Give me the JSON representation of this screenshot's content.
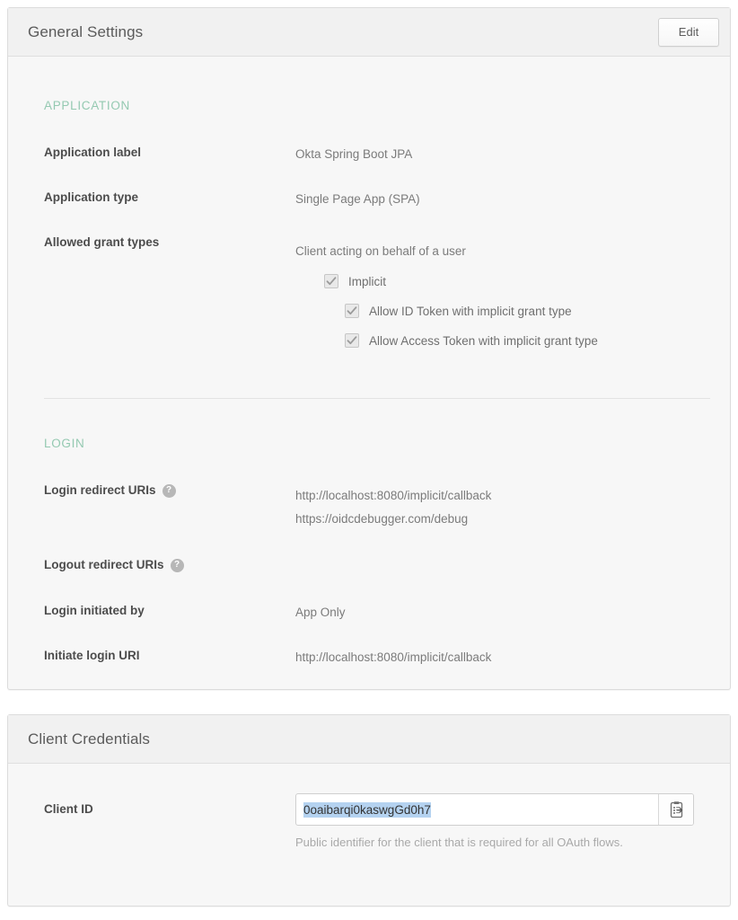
{
  "general_settings": {
    "title": "General Settings",
    "edit_label": "Edit",
    "application": {
      "heading": "APPLICATION",
      "rows": [
        {
          "label": "Application label",
          "value": "Okta Spring Boot JPA"
        },
        {
          "label": "Application type",
          "value": "Single Page App (SPA)"
        }
      ],
      "grant_types": {
        "label": "Allowed grant types",
        "group_label": "Client acting on behalf of a user",
        "checkboxes": [
          {
            "label": "Implicit",
            "checked": true,
            "indent": 0
          },
          {
            "label": "Allow ID Token with implicit grant type",
            "checked": true,
            "indent": 1
          },
          {
            "label": "Allow Access Token with implicit grant type",
            "checked": true,
            "indent": 1
          }
        ]
      }
    },
    "login": {
      "heading": "LOGIN",
      "login_redirect_uris": {
        "label": "Login redirect URIs",
        "help": "?",
        "values": [
          "http://localhost:8080/implicit/callback",
          "https://oidcdebugger.com/debug"
        ]
      },
      "logout_redirect_uris": {
        "label": "Logout redirect URIs",
        "help": "?",
        "values": []
      },
      "login_initiated_by": {
        "label": "Login initiated by",
        "value": "App Only"
      },
      "initiate_login_uri": {
        "label": "Initiate login URI",
        "value": "http://localhost:8080/implicit/callback"
      }
    }
  },
  "client_credentials": {
    "title": "Client Credentials",
    "client_id": {
      "label": "Client ID",
      "value": "0oaibarqi0kaswgGd0h7",
      "hint": "Public identifier for the client that is required for all OAuth flows.",
      "copy_icon": "clipboard-copy-icon"
    }
  },
  "colors": {
    "accent_green": "#94c9b1",
    "selection_blue": "#b4d2f0",
    "panel_bg": "#f7f7f7",
    "header_bg": "#f1f1f1"
  }
}
